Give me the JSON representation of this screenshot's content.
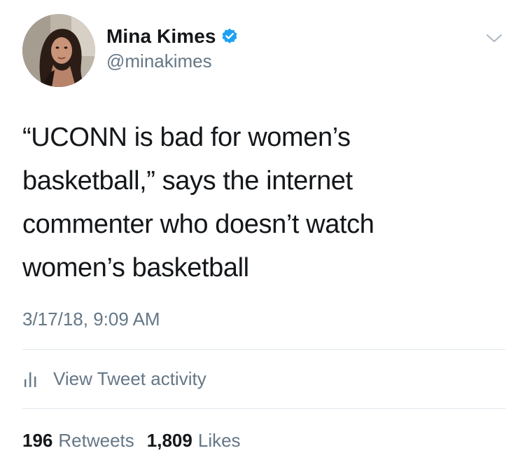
{
  "author": {
    "name": "Mina Kimes",
    "handle": "@minakimes",
    "verified": true
  },
  "tweet": {
    "text": "“UCONN is bad for women’s\nbasketball,” says the internet\ncommenter who doesn’t watch\nwomen’s basketball",
    "timestamp": "3/17/18, 9:09 AM"
  },
  "activity": {
    "label": "View Tweet activity",
    "icon": "bar-chart-icon"
  },
  "stats": {
    "retweets_count": "196",
    "retweets_label": "Retweets",
    "likes_count": "1,809",
    "likes_label": "Likes"
  },
  "colors": {
    "primary_text": "#14171a",
    "secondary_text": "#657786",
    "verified_blue": "#1da1f2",
    "divider": "#e1e8ed"
  }
}
